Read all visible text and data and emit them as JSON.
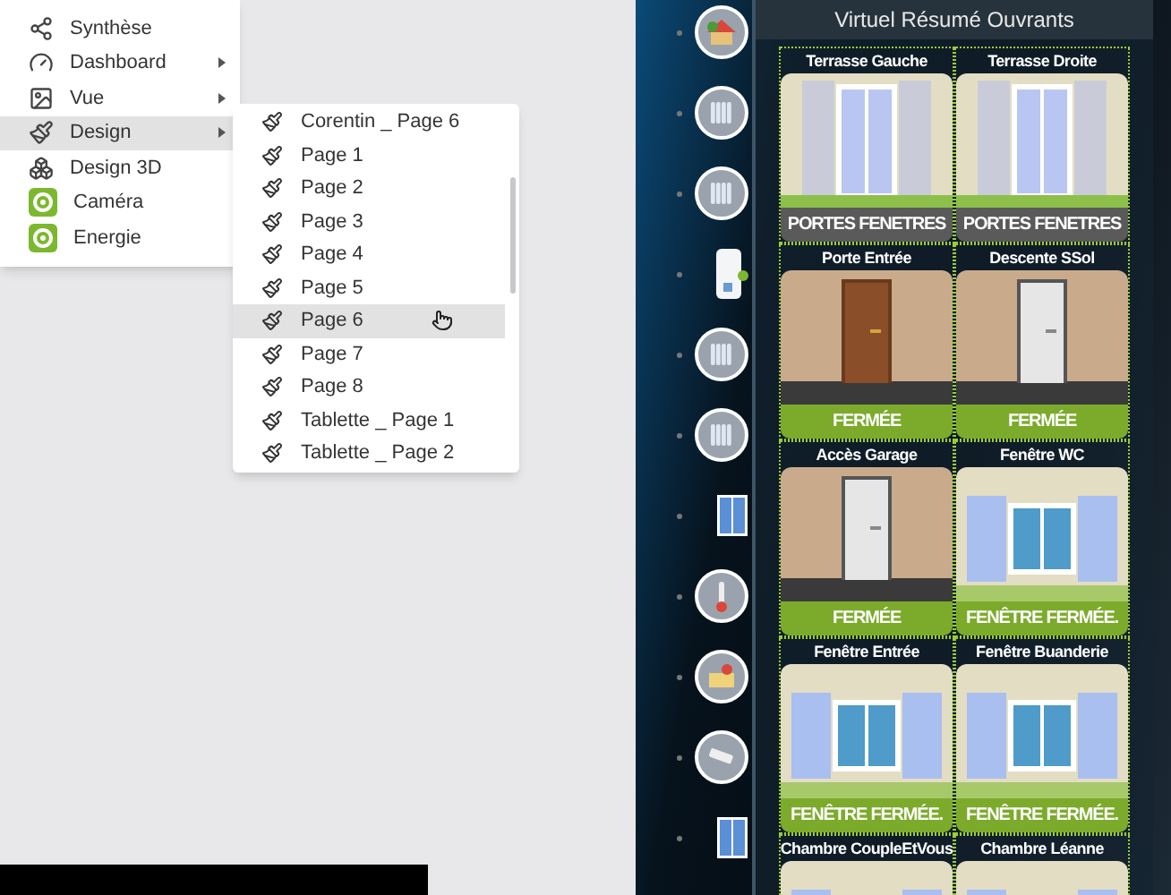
{
  "menu": {
    "items": [
      {
        "label": "Synthèse",
        "kind": "hub",
        "has_submenu": false,
        "selected": false
      },
      {
        "label": "Dashboard",
        "kind": "gauge",
        "has_submenu": true,
        "selected": false
      },
      {
        "label": "Vue",
        "kind": "image",
        "has_submenu": true,
        "selected": false
      },
      {
        "label": "Design",
        "kind": "brush",
        "has_submenu": true,
        "selected": true
      },
      {
        "label": "Design 3D",
        "kind": "cubes",
        "has_submenu": false,
        "selected": false
      },
      {
        "label": "Caméra",
        "kind": "app-camera",
        "has_submenu": false,
        "selected": false
      },
      {
        "label": "Energie",
        "kind": "app-energy",
        "has_submenu": false,
        "selected": false
      }
    ]
  },
  "submenu": {
    "items": [
      {
        "label": "Corentin _ Page 6",
        "selected": false
      },
      {
        "label": "Page 1",
        "selected": false
      },
      {
        "label": "Page 2",
        "selected": false
      },
      {
        "label": "Page 3",
        "selected": false
      },
      {
        "label": "Page 4",
        "selected": false
      },
      {
        "label": "Page 5",
        "selected": false
      },
      {
        "label": "Page 6",
        "selected": true
      },
      {
        "label": "Page 7",
        "selected": false
      },
      {
        "label": "Page 8",
        "selected": false
      },
      {
        "label": "Tablette _ Page 1",
        "selected": false
      },
      {
        "label": "Tablette _ Page 2",
        "selected": false
      }
    ]
  },
  "devices": [
    {
      "kind": "house"
    },
    {
      "kind": "radiator"
    },
    {
      "kind": "radiator"
    },
    {
      "kind": "water-heater"
    },
    {
      "kind": "radiator"
    },
    {
      "kind": "radiator"
    },
    {
      "kind": "window"
    },
    {
      "kind": "thermometer"
    },
    {
      "kind": "map"
    },
    {
      "kind": "camera"
    },
    {
      "kind": "window"
    }
  ],
  "panel": {
    "title": "Virtuel Résumé Ouvrants",
    "tiles": [
      {
        "name": "Terrasse Gauche",
        "kind": "french-window",
        "status": "PORTES FENETRES",
        "color": "#5a5a5a"
      },
      {
        "name": "Terrasse Droite",
        "kind": "french-window",
        "status": "PORTES FENETRES",
        "color": "#5a5a5a"
      },
      {
        "name": "Porte Entrée",
        "kind": "wood-door",
        "status": "FERMÉE",
        "color": "#7cab2c"
      },
      {
        "name": "Descente SSol",
        "kind": "white-door",
        "status": "FERMÉE",
        "color": "#7cab2c"
      },
      {
        "name": "Accès Garage",
        "kind": "white-door",
        "status": "FERMÉE",
        "color": "#7cab2c"
      },
      {
        "name": "Fenêtre WC",
        "kind": "window",
        "status": "FENÊTRE FERMÉE.",
        "color": "#7cab2c"
      },
      {
        "name": "Fenêtre Entrée",
        "kind": "window",
        "status": "FENÊTRE FERMÉE.",
        "color": "#7cab2c"
      },
      {
        "name": "Fenêtre Buanderie",
        "kind": "window",
        "status": "FENÊTRE FERMÉE.",
        "color": "#7cab2c"
      },
      {
        "name": "Chambre CoupleEtVous",
        "kind": "window"
      },
      {
        "name": "Chambre Léanne",
        "kind": "window"
      }
    ]
  }
}
